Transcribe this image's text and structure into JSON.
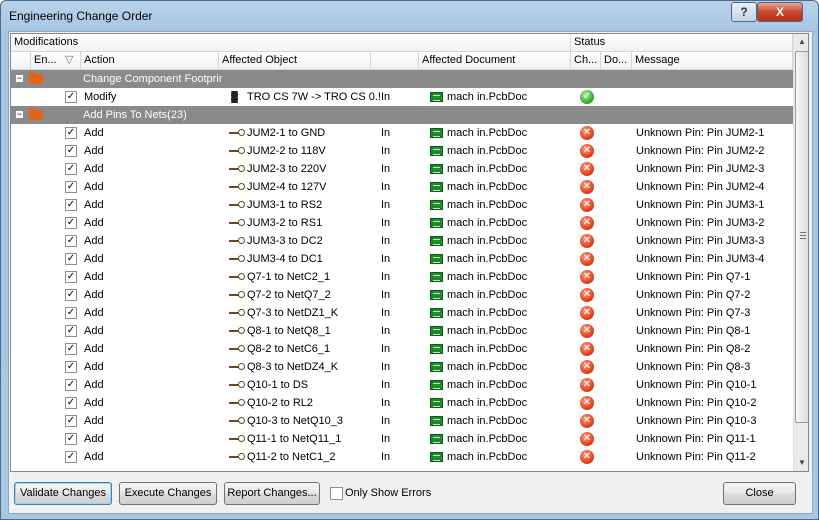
{
  "window": {
    "title": "Engineering Change Order",
    "help_label": "?",
    "close_label": "X"
  },
  "grid": {
    "bands": {
      "modifications": "Modifications",
      "status": "Status"
    },
    "columns": {
      "enable": "En...",
      "action": "Action",
      "affected_object": "Affected Object",
      "affected_document": "Affected Document",
      "check": "Ch...",
      "done": "Do...",
      "message": "Message"
    }
  },
  "groups": [
    {
      "label": "Change Component Footprir",
      "expander": "−",
      "rows": [
        {
          "enabled": "✓",
          "action": "Modify",
          "object": "TRO CS 7W -> TRO CS 0.!",
          "direction": "In",
          "document": "mach in.PcbDoc",
          "status": "ok",
          "status_glyph": "✓",
          "message": ""
        }
      ]
    },
    {
      "label": "Add Pins To Nets(23)",
      "expander": "−",
      "rows": [
        {
          "enabled": "✓",
          "action": "Add",
          "object": "JUM2-1 to GND",
          "direction": "In",
          "document": "mach in.PcbDoc",
          "status": "error",
          "status_glyph": "✕",
          "message": "Unknown Pin: Pin JUM2-1"
        },
        {
          "enabled": "✓",
          "action": "Add",
          "object": "JUM2-2 to 118V",
          "direction": "In",
          "document": "mach in.PcbDoc",
          "status": "error",
          "status_glyph": "✕",
          "message": "Unknown Pin: Pin JUM2-2"
        },
        {
          "enabled": "✓",
          "action": "Add",
          "object": "JUM2-3 to 220V",
          "direction": "In",
          "document": "mach in.PcbDoc",
          "status": "error",
          "status_glyph": "✕",
          "message": "Unknown Pin: Pin JUM2-3"
        },
        {
          "enabled": "✓",
          "action": "Add",
          "object": "JUM2-4 to 127V",
          "direction": "In",
          "document": "mach in.PcbDoc",
          "status": "error",
          "status_glyph": "✕",
          "message": "Unknown Pin: Pin JUM2-4"
        },
        {
          "enabled": "✓",
          "action": "Add",
          "object": "JUM3-1 to RS2",
          "direction": "In",
          "document": "mach in.PcbDoc",
          "status": "error",
          "status_glyph": "✕",
          "message": "Unknown Pin: Pin JUM3-1"
        },
        {
          "enabled": "✓",
          "action": "Add",
          "object": "JUM3-2 to RS1",
          "direction": "In",
          "document": "mach in.PcbDoc",
          "status": "error",
          "status_glyph": "✕",
          "message": "Unknown Pin: Pin JUM3-2"
        },
        {
          "enabled": "✓",
          "action": "Add",
          "object": "JUM3-3 to DC2",
          "direction": "In",
          "document": "mach in.PcbDoc",
          "status": "error",
          "status_glyph": "✕",
          "message": "Unknown Pin: Pin JUM3-3"
        },
        {
          "enabled": "✓",
          "action": "Add",
          "object": "JUM3-4 to DC1",
          "direction": "In",
          "document": "mach in.PcbDoc",
          "status": "error",
          "status_glyph": "✕",
          "message": "Unknown Pin: Pin JUM3-4"
        },
        {
          "enabled": "✓",
          "action": "Add",
          "object": "Q7-1 to NetC2_1",
          "direction": "In",
          "document": "mach in.PcbDoc",
          "status": "error",
          "status_glyph": "✕",
          "message": "Unknown Pin: Pin Q7-1"
        },
        {
          "enabled": "✓",
          "action": "Add",
          "object": "Q7-2 to NetQ7_2",
          "direction": "In",
          "document": "mach in.PcbDoc",
          "status": "error",
          "status_glyph": "✕",
          "message": "Unknown Pin: Pin Q7-2"
        },
        {
          "enabled": "✓",
          "action": "Add",
          "object": "Q7-3 to NetDZ1_K",
          "direction": "In",
          "document": "mach in.PcbDoc",
          "status": "error",
          "status_glyph": "✕",
          "message": "Unknown Pin: Pin Q7-3"
        },
        {
          "enabled": "✓",
          "action": "Add",
          "object": "Q8-1 to NetQ8_1",
          "direction": "In",
          "document": "mach in.PcbDoc",
          "status": "error",
          "status_glyph": "✕",
          "message": "Unknown Pin: Pin Q8-1"
        },
        {
          "enabled": "✓",
          "action": "Add",
          "object": "Q8-2 to NetC6_1",
          "direction": "In",
          "document": "mach in.PcbDoc",
          "status": "error",
          "status_glyph": "✕",
          "message": "Unknown Pin: Pin Q8-2"
        },
        {
          "enabled": "✓",
          "action": "Add",
          "object": "Q8-3 to NetDZ4_K",
          "direction": "In",
          "document": "mach in.PcbDoc",
          "status": "error",
          "status_glyph": "✕",
          "message": "Unknown Pin: Pin Q8-3"
        },
        {
          "enabled": "✓",
          "action": "Add",
          "object": "Q10-1 to DS",
          "direction": "In",
          "document": "mach in.PcbDoc",
          "status": "error",
          "status_glyph": "✕",
          "message": "Unknown Pin: Pin Q10-1"
        },
        {
          "enabled": "✓",
          "action": "Add",
          "object": "Q10-2 to RL2",
          "direction": "In",
          "document": "mach in.PcbDoc",
          "status": "error",
          "status_glyph": "✕",
          "message": "Unknown Pin: Pin Q10-2"
        },
        {
          "enabled": "✓",
          "action": "Add",
          "object": "Q10-3 to NetQ10_3",
          "direction": "In",
          "document": "mach in.PcbDoc",
          "status": "error",
          "status_glyph": "✕",
          "message": "Unknown Pin: Pin Q10-3"
        },
        {
          "enabled": "✓",
          "action": "Add",
          "object": "Q11-1 to NetQ11_1",
          "direction": "In",
          "document": "mach in.PcbDoc",
          "status": "error",
          "status_glyph": "✕",
          "message": "Unknown Pin: Pin Q11-1"
        },
        {
          "enabled": "✓",
          "action": "Add",
          "object": "Q11-2 to NetC1_2",
          "direction": "In",
          "document": "mach in.PcbDoc",
          "status": "error",
          "status_glyph": "✕",
          "message": "Unknown Pin: Pin Q11-2"
        }
      ]
    }
  ],
  "scrollbar": {
    "up_glyph": "▲",
    "down_glyph": "▼"
  },
  "buttons": {
    "validate": "Validate Changes",
    "execute": "Execute Changes",
    "report": "Report Changes...",
    "only_show_errors": "Only Show Errors",
    "close": "Close"
  },
  "colors": {
    "group_row": "#8a8a8a",
    "error": "#e0441f",
    "ok": "#35b02e",
    "document_icon": "#1f8a2c"
  }
}
